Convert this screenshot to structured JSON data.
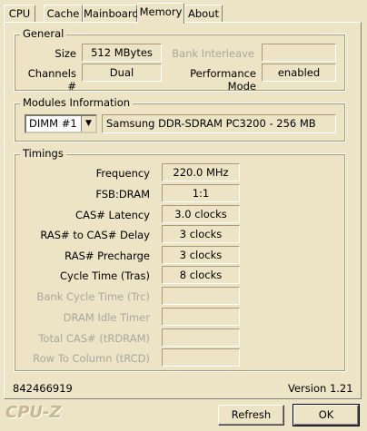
{
  "tabs": [
    "CPU",
    "Cache",
    "Mainboard",
    "Memory",
    "About"
  ],
  "general": {
    "title": "General",
    "size_label": "Size",
    "size_value": "512 MBytes",
    "channels_label": "Channels #",
    "channels_value": "Dual",
    "bank_interleave_label": "Bank Interleave",
    "bank_interleave_value": "",
    "performance_mode_label": "Performance Mode",
    "performance_mode_value": "enabled"
  },
  "modules": {
    "title": "Modules Information",
    "selected_dimm": "DIMM #1",
    "module_desc": "Samsung DDR-SDRAM PC3200 - 256 MB"
  },
  "timings": {
    "title": "Timings",
    "frequency_label": "Frequency",
    "frequency_value": "220.0 MHz",
    "fsb_dram_label": "FSB:DRAM",
    "fsb_dram_value": "1:1",
    "cas_latency_label": "CAS# Latency",
    "cas_latency_value": "3.0 clocks",
    "ras_to_cas_label": "RAS# to CAS# Delay",
    "ras_to_cas_value": "3 clocks",
    "ras_precharge_label": "RAS# Precharge",
    "ras_precharge_value": "3 clocks",
    "cycle_time_label": "Cycle Time (Tras)",
    "cycle_time_value": "8 clocks",
    "bank_cycle_label": "Bank Cycle Time (Trc)",
    "dram_idle_label": "DRAM Idle Timer",
    "total_cas_label": "Total CAS# (tRDRAM)",
    "row_to_col_label": "Row To Column (tRCD)"
  },
  "status": {
    "id": "842466919",
    "version": "Version 1.21"
  },
  "footer": {
    "logo": "CPU-Z",
    "refresh_label": "Refresh",
    "ok_label": "OK"
  }
}
